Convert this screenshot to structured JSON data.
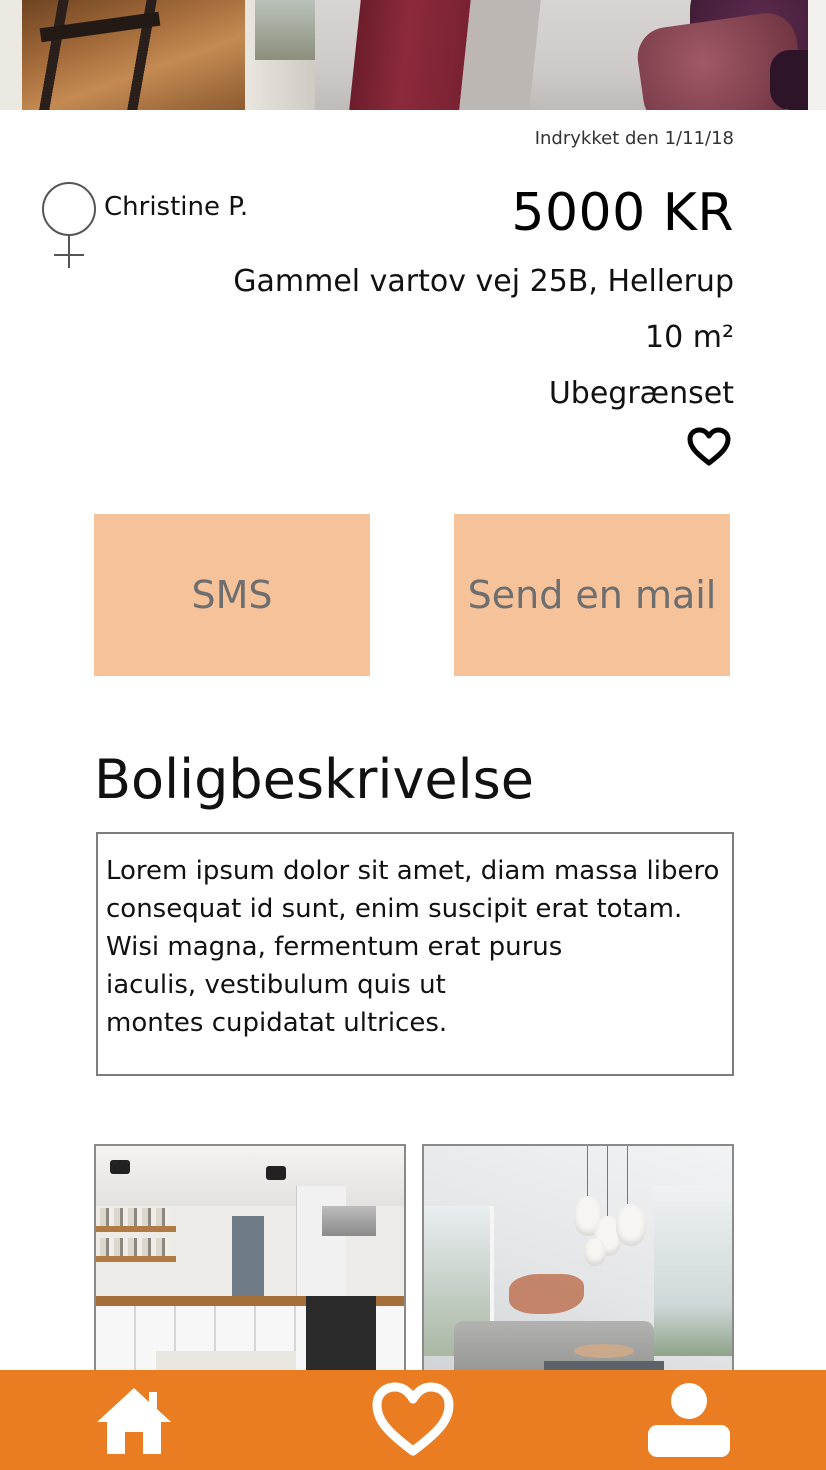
{
  "listing": {
    "posted_date": "Indrykket den 1/11/18",
    "owner_name": "Christine P.",
    "price": "5000 KR",
    "address": "Gammel vartov vej 25B, Hellerup",
    "area": "10 m²",
    "rental_period": "Ubegrænset"
  },
  "actions": {
    "sms_label": "SMS",
    "mail_label": "Send en mail"
  },
  "description": {
    "title": "Boligbeskrivelse",
    "lines": [
      "Lorem ipsum dolor sit amet, diam massa libero",
      "consequat id sunt, enim suscipit erat totam.",
      "Wisi magna, fermentum erat purus",
      "iaculis, vestibulum quis ut",
      "montes cupidatat ultrices."
    ]
  },
  "icons": {
    "owner_gender": "female-symbol-icon",
    "favorite": "heart-outline-icon",
    "nav_home": "home-icon",
    "nav_favorites": "heart-outline-icon",
    "nav_profile": "user-icon"
  },
  "colors": {
    "accent": "#ea7c22",
    "button_bg": "#f5c29a",
    "button_text": "#6e6e6e"
  }
}
